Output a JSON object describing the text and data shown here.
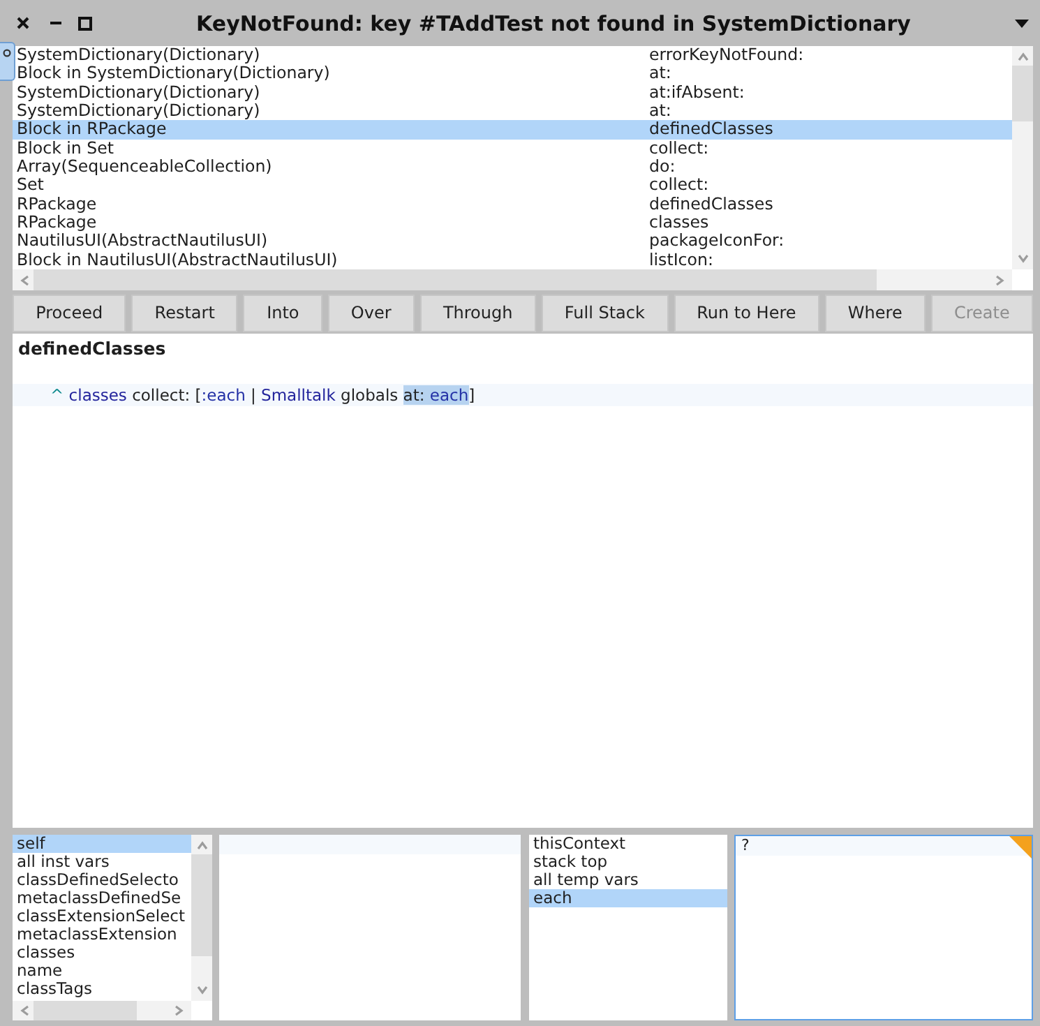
{
  "window": {
    "title": "KeyNotFound: key #TAddTest not found in SystemDictionary"
  },
  "stack": {
    "rows": [
      {
        "receiver": "SystemDictionary(Dictionary)",
        "method": "errorKeyNotFound:",
        "selected": false
      },
      {
        "receiver": "Block in SystemDictionary(Dictionary)",
        "method": "at:",
        "selected": false
      },
      {
        "receiver": "SystemDictionary(Dictionary)",
        "method": "at:ifAbsent:",
        "selected": false
      },
      {
        "receiver": "SystemDictionary(Dictionary)",
        "method": "at:",
        "selected": false
      },
      {
        "receiver": "Block in RPackage",
        "method": "definedClasses",
        "selected": true
      },
      {
        "receiver": "Block in Set",
        "method": "collect:",
        "selected": false
      },
      {
        "receiver": "Array(SequenceableCollection)",
        "method": "do:",
        "selected": false
      },
      {
        "receiver": "Set",
        "method": "collect:",
        "selected": false
      },
      {
        "receiver": "RPackage",
        "method": "definedClasses",
        "selected": false
      },
      {
        "receiver": "RPackage",
        "method": "classes",
        "selected": false
      },
      {
        "receiver": "NautilusUI(AbstractNautilusUI)",
        "method": "packageIconFor:",
        "selected": false
      },
      {
        "receiver": "Block in NautilusUI(AbstractNautilusUI)",
        "method": "listIcon:",
        "selected": false
      }
    ]
  },
  "toolbar": {
    "buttons": [
      {
        "label": "Proceed",
        "disabled": false
      },
      {
        "label": "Restart",
        "disabled": false
      },
      {
        "label": "Into",
        "disabled": false
      },
      {
        "label": "Over",
        "disabled": false
      },
      {
        "label": "Through",
        "disabled": false
      },
      {
        "label": "Full Stack",
        "disabled": false
      },
      {
        "label": "Run to Here",
        "disabled": false
      },
      {
        "label": "Where",
        "disabled": false
      },
      {
        "label": "Create",
        "disabled": true
      }
    ]
  },
  "code": {
    "selector": "definedClasses",
    "line": [
      {
        "text": "^ ",
        "kind": "return",
        "selected": false
      },
      {
        "text": "classes",
        "kind": "variable",
        "selected": false
      },
      {
        "text": " collect: [",
        "kind": "plain",
        "selected": false
      },
      {
        "text": ":each",
        "kind": "argument",
        "selected": false
      },
      {
        "text": " | ",
        "kind": "plain",
        "selected": false
      },
      {
        "text": "Smalltalk",
        "kind": "global",
        "selected": false
      },
      {
        "text": " globals ",
        "kind": "plain",
        "selected": false
      },
      {
        "text": "at: ",
        "kind": "plain",
        "selected": true
      },
      {
        "text": "each",
        "kind": "argument",
        "selected": true
      },
      {
        "text": "]",
        "kind": "plain",
        "selected": false
      }
    ]
  },
  "receiver_inspector": {
    "fields": [
      {
        "label": "self",
        "selected": true
      },
      {
        "label": "all inst vars",
        "selected": false
      },
      {
        "label": "classDefinedSelecto",
        "selected": false
      },
      {
        "label": "metaclassDefinedSe",
        "selected": false
      },
      {
        "label": "classExtensionSelect",
        "selected": false
      },
      {
        "label": "metaclassExtension",
        "selected": false
      },
      {
        "label": "classes",
        "selected": false
      },
      {
        "label": "name",
        "selected": false
      },
      {
        "label": "classTags",
        "selected": false
      }
    ]
  },
  "context_inspector": {
    "fields": [
      {
        "label": "thisContext",
        "selected": false
      },
      {
        "label": "stack top",
        "selected": false
      },
      {
        "label": "all temp vars",
        "selected": false
      },
      {
        "label": "each",
        "selected": true
      }
    ]
  },
  "context_value": {
    "value": "?",
    "edited": true
  }
}
